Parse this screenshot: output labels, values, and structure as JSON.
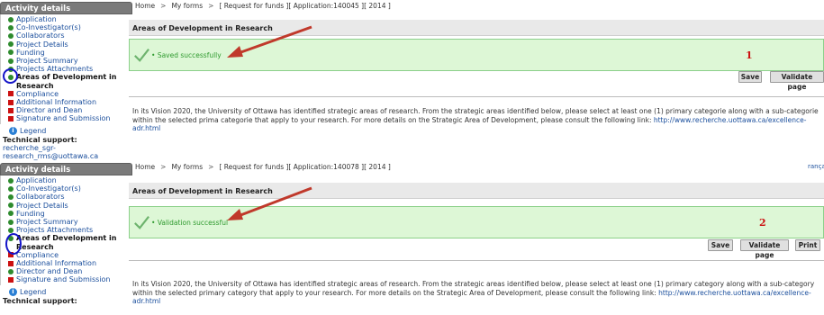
{
  "sidebar": {
    "title": "Activity details",
    "items": [
      {
        "label": "Application",
        "status": "green"
      },
      {
        "label": "Co-Investigator(s)",
        "status": "green"
      },
      {
        "label": "Collaborators",
        "status": "green"
      },
      {
        "label": "Project Details",
        "status": "green"
      },
      {
        "label": "Funding",
        "status": "green"
      },
      {
        "label": "Project Summary",
        "status": "green"
      },
      {
        "label": "Projects Attachments",
        "status": "green"
      },
      {
        "label": "Areas of Development in Research",
        "status": "green",
        "active": true
      },
      {
        "label": "Compliance",
        "status": "red"
      },
      {
        "label": "Additional Information",
        "status": "red"
      },
      {
        "label": "Director and Dean",
        "status": "red"
      },
      {
        "label": "Signature and Submission",
        "status": "red"
      }
    ],
    "items2": [
      {
        "label": "Application",
        "status": "green"
      },
      {
        "label": "Co-Investigator(s)",
        "status": "green"
      },
      {
        "label": "Collaborators",
        "status": "green"
      },
      {
        "label": "Project Details",
        "status": "green"
      },
      {
        "label": "Funding",
        "status": "green"
      },
      {
        "label": "Project Summary",
        "status": "green"
      },
      {
        "label": "Projects Attachments",
        "status": "green"
      },
      {
        "label": "Areas of Development in Research",
        "status": "green",
        "active": true
      },
      {
        "label": "Compliance",
        "status": "red"
      },
      {
        "label": "Additional Information",
        "status": "red"
      },
      {
        "label": "Director and Dean",
        "status": "green"
      },
      {
        "label": "Signature and Submission",
        "status": "red"
      }
    ],
    "legend": "Legend",
    "tech_support": "Technical support:",
    "email": "recherche_sgr-research_rms@uottawa.ca"
  },
  "panel1": {
    "crumb_home": "Home",
    "crumb_forms": "My forms",
    "crumb_request": "[ Request for funds ][ Application:140045 ][ 2014 ]",
    "section_title": "Areas of Development in Research",
    "message": "Saved successfully",
    "number": "1",
    "save_label": "Save",
    "validate_label": "Validate page",
    "intro_text": "In its Vision 2020, the University of Ottawa has identified strategic areas of research. From the strategic areas identified below, please select at least one (1) primary categorie along with a sub-categorie within the selected prima categorie that apply to your research. For more details on the Strategic Area of Development, please consult the following link: ",
    "link": "http://www.recherche.uottawa.ca/excellence-adr.html"
  },
  "panel2": {
    "crumb_home": "Home",
    "crumb_forms": "My forms",
    "crumb_request": "[ Request for funds ][ Application:140078 ][ 2014 ]",
    "section_title": "Areas of Development in Research",
    "message": "Validation successful",
    "number": "2",
    "save_label": "Save",
    "validate_label": "Validate page",
    "print_label": "Print",
    "francais": "rançai",
    "intro_text": "In its Vision 2020, the University of Ottawa has identified strategic areas of research. From the strategic areas identified below, please select at least one (1) primary category along with a sub-category within the selected primary category that apply to your research. For more details on the Strategic Area of Development, please consult the following link: ",
    "link": "http://www.recherche.uottawa.ca/excellence-adr.html"
  },
  "colors": {
    "success_bg": "#ddf7d6",
    "success_text": "#2e9a2e",
    "complete_dot": "#2e8b2e",
    "incomplete_square": "#cc1111",
    "annotation_arrow": "#c0392b",
    "annotation_circle": "#1515c8"
  },
  "icons": [
    "checkmark-icon",
    "info-icon",
    "status-dot-icon",
    "status-square-icon"
  ]
}
